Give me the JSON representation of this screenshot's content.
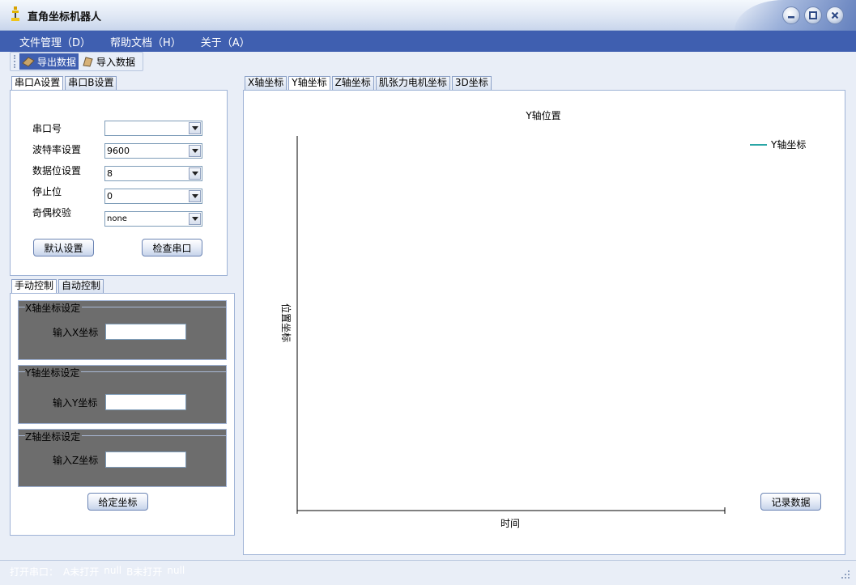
{
  "window": {
    "title": "直角坐标机器人",
    "controls": [
      "minimize-icon",
      "restore-icon",
      "close-icon"
    ]
  },
  "menu": [
    {
      "label": "文件管理（D）"
    },
    {
      "label": "帮助文档（H）"
    },
    {
      "label": "关于（A）"
    }
  ],
  "toolbar": {
    "export_label": "导出数据",
    "import_label": "导入数据"
  },
  "serial": {
    "tabs": [
      "串口A设置",
      "串口B设置"
    ],
    "fields": [
      {
        "label": "串口号",
        "value": ""
      },
      {
        "label": "波特率设置",
        "value": "9600"
      },
      {
        "label": "数据位设置",
        "value": "8"
      },
      {
        "label": "停止位",
        "value": "0"
      },
      {
        "label": "奇偶校验",
        "value": "none"
      }
    ],
    "default_button": "默认设置",
    "check_button": "检查串口"
  },
  "control": {
    "tabs": [
      "手动控制",
      "自动控制"
    ],
    "groups": [
      {
        "title": "X轴坐标设定",
        "label": "输入X坐标",
        "value": ""
      },
      {
        "title": "Y轴坐标设定",
        "label": "输入Y坐标",
        "value": ""
      },
      {
        "title": "Z轴坐标设定",
        "label": "输入Z坐标",
        "value": ""
      }
    ],
    "submit_button": "给定坐标"
  },
  "chart_tabs": [
    "X轴坐标",
    "Y轴坐标",
    "Z轴坐标",
    "肌张力电机坐标",
    "3D坐标"
  ],
  "chart_data": {
    "type": "line",
    "title": "Y轴位置",
    "xlabel": "时间",
    "ylabel": "位置坐标",
    "series": [
      {
        "name": "Y轴坐标",
        "values": []
      }
    ],
    "legend": "top-right",
    "grid": false,
    "series_color": "#2aa6a6"
  },
  "record_button": "记录数据",
  "status": {
    "open_label": "打开串口：",
    "a_text": "A未打开",
    "a_value": "null",
    "b_text": "B未打开",
    "b_value": "null"
  },
  "colors": {
    "menubar": "#3f5fb0",
    "accent": "#3f5fb0"
  }
}
